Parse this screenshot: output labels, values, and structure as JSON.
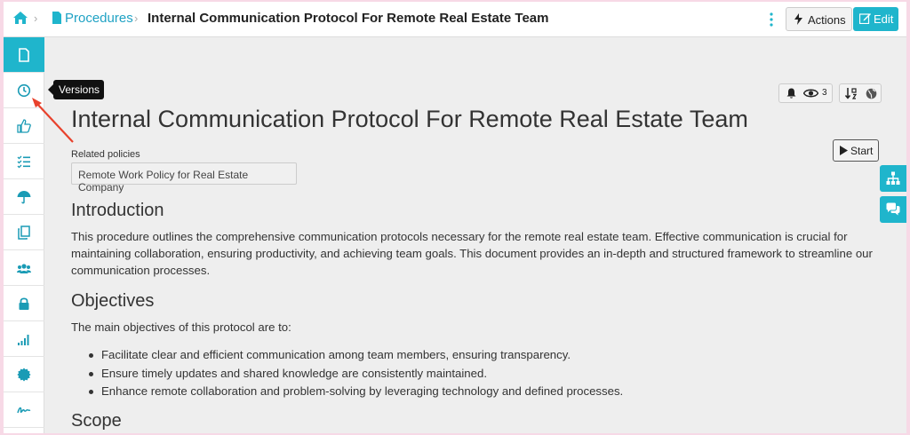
{
  "breadcrumb": {
    "section": "Procedures",
    "current": "Internal Communication Protocol For Remote Real Estate Team"
  },
  "toolbar": {
    "actions_label": "Actions",
    "edit_label": "Edit"
  },
  "sidebar": {
    "items": [
      {
        "name": "document-icon",
        "active": true
      },
      {
        "name": "clock-icon",
        "active": false
      },
      {
        "name": "thumbs-up-icon",
        "active": false
      },
      {
        "name": "checklist-icon",
        "active": false
      },
      {
        "name": "umbrella-icon",
        "active": false
      },
      {
        "name": "copy-icon",
        "active": false
      },
      {
        "name": "users-icon",
        "active": false
      },
      {
        "name": "lock-icon",
        "active": false
      },
      {
        "name": "signal-icon",
        "active": false
      },
      {
        "name": "certificate-icon",
        "active": false
      },
      {
        "name": "signature-icon",
        "active": false
      }
    ],
    "tooltip": "Versions"
  },
  "badges": {
    "views_count": "3"
  },
  "document": {
    "title": "Internal Communication Protocol For Remote Real Estate Team",
    "related_policies_label": "Related policies",
    "related_policies": [
      "Remote Work Policy for Real Estate Company"
    ],
    "start_label": "Start",
    "sections": {
      "introduction": {
        "heading": "Introduction",
        "text": "This procedure outlines the comprehensive communication protocols necessary for the remote real estate team. Effective communication is crucial for maintaining collaboration, ensuring productivity, and achieving team goals. This document provides an in-depth and structured framework to streamline our communication processes."
      },
      "objectives": {
        "heading": "Objectives",
        "intro": "The main objectives of this protocol are to:",
        "bullets": [
          "Facilitate clear and efficient communication among team members, ensuring transparency.",
          "Ensure timely updates and shared knowledge are consistently maintained.",
          "Enhance remote collaboration and problem-solving by leveraging technology and defined processes."
        ]
      },
      "scope": {
        "heading": "Scope"
      }
    }
  },
  "colors": {
    "accent": "#1fb5cc",
    "link": "#1fa2c4",
    "annotation_arrow": "#e8412c",
    "page_background": "#eeeeee"
  }
}
